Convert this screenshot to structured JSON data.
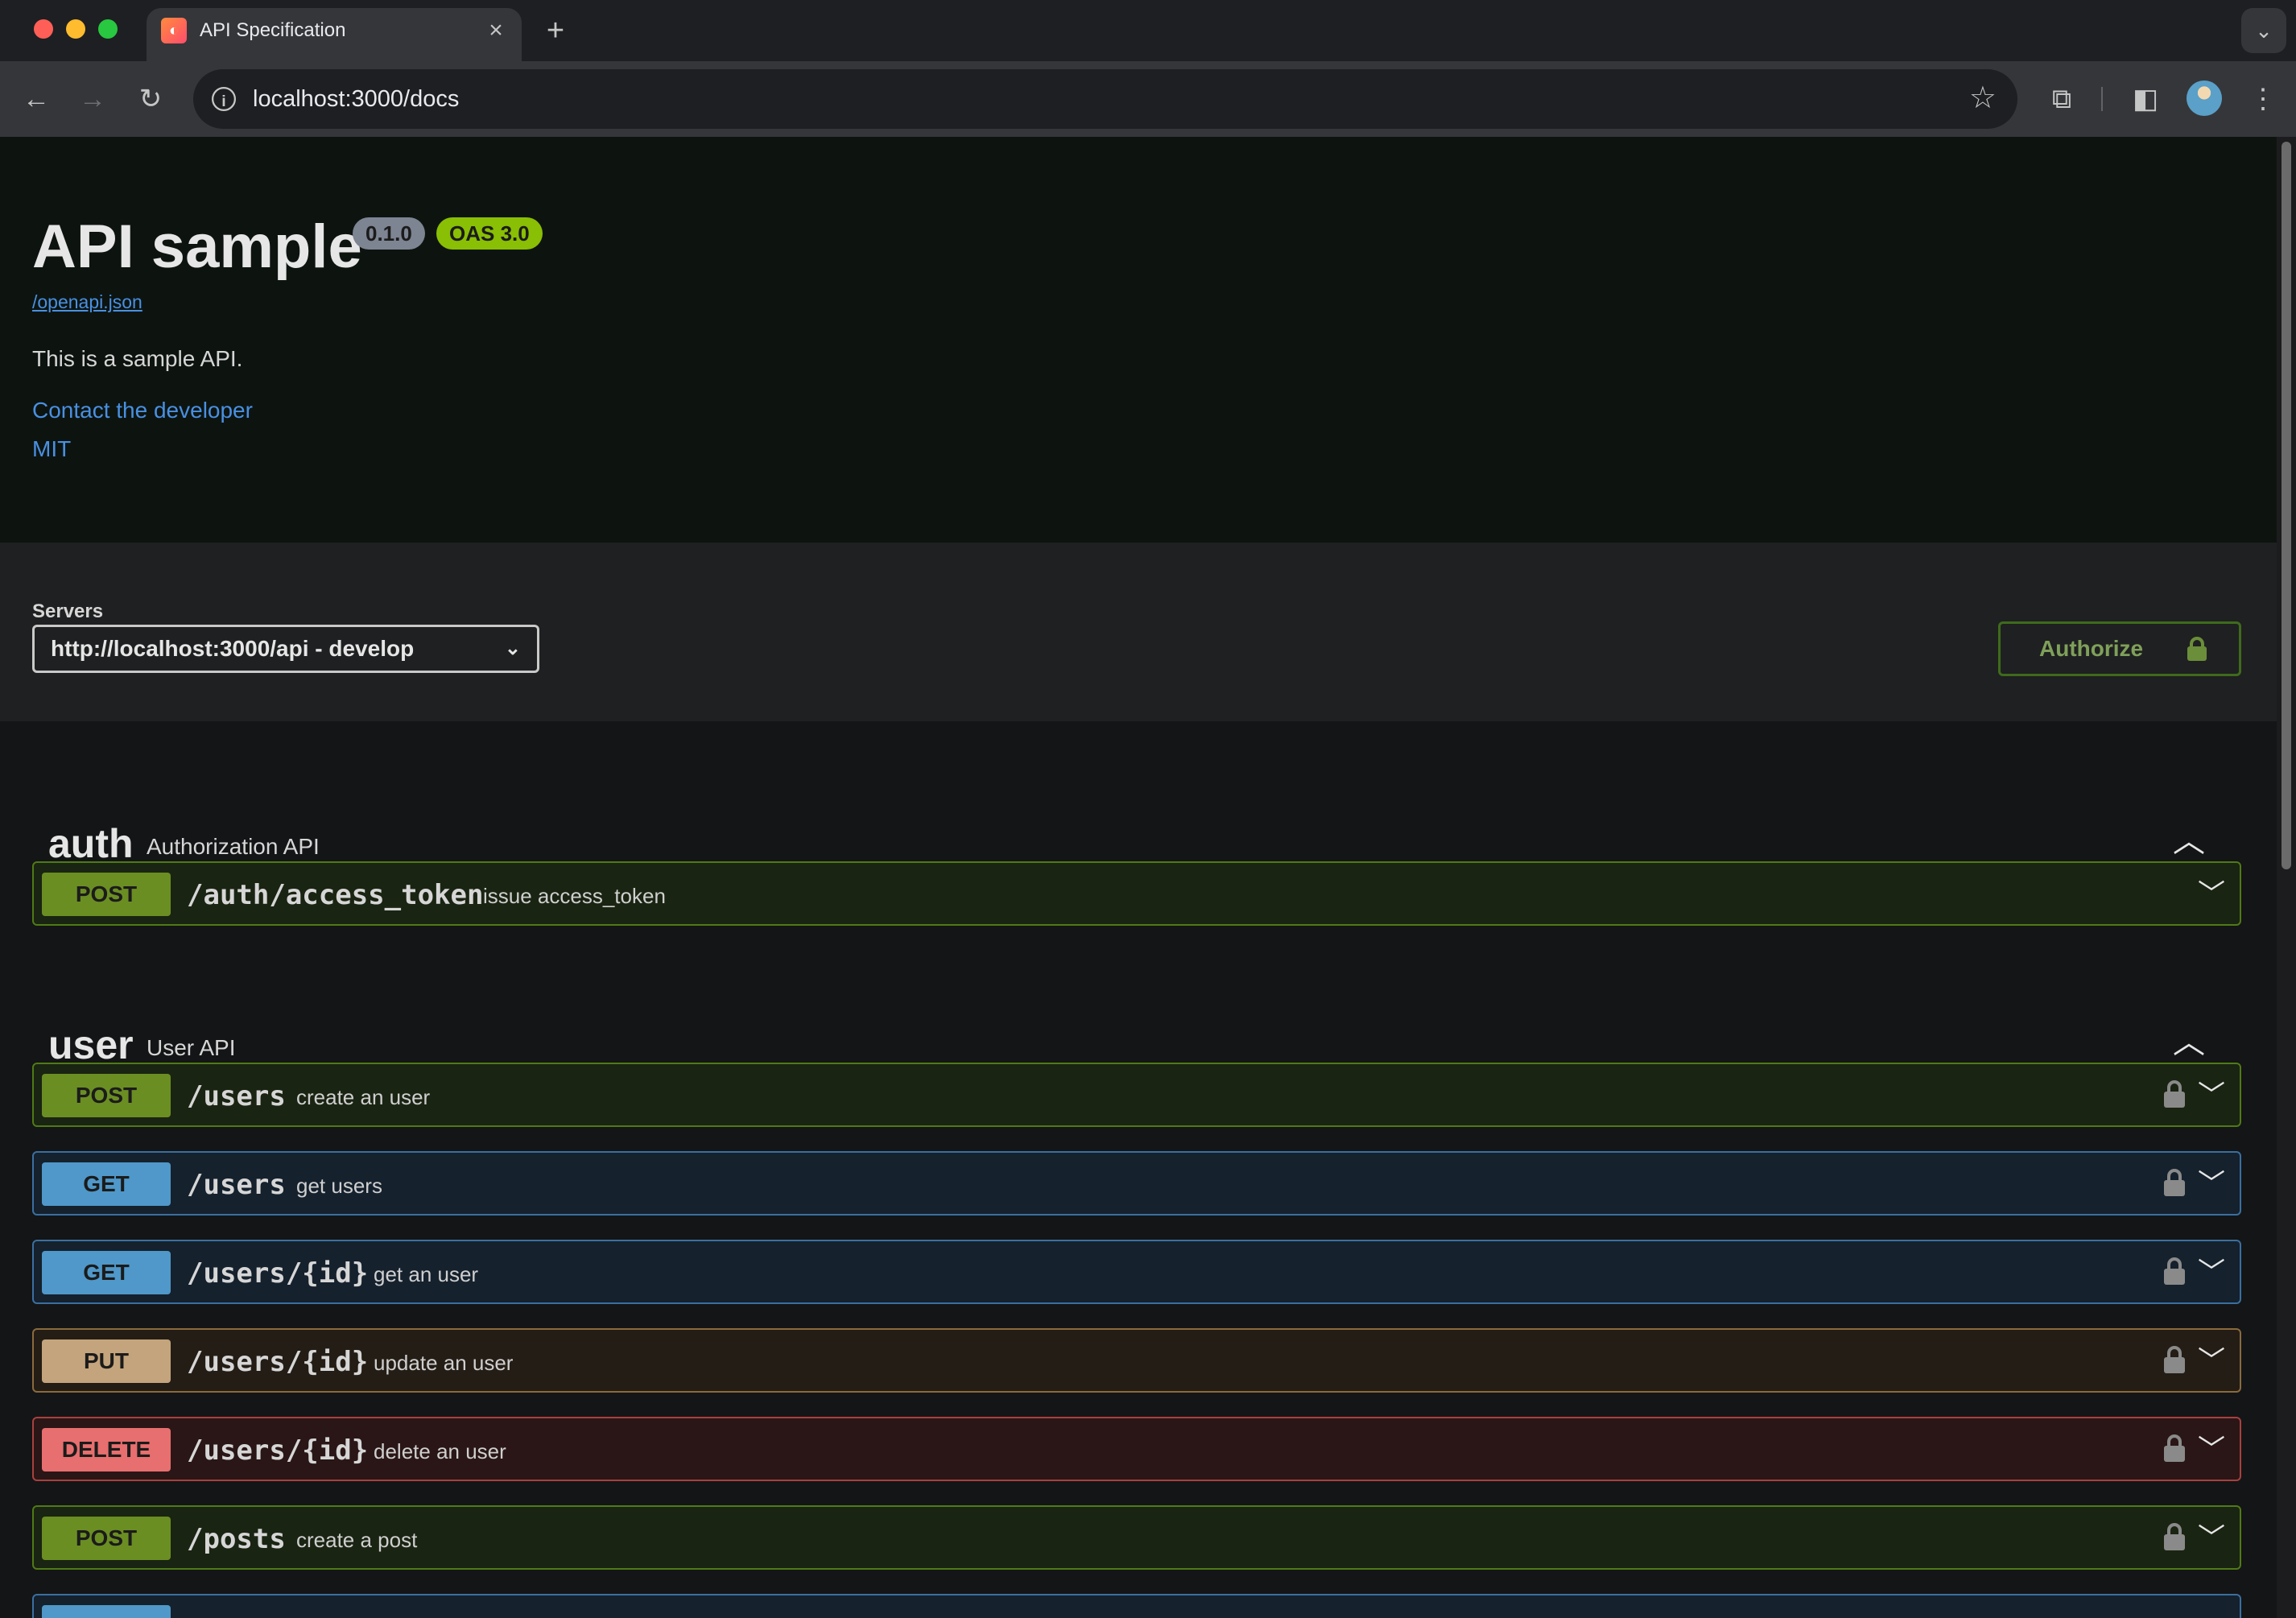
{
  "browser": {
    "tab_title": "API Specification",
    "tab_close": "×",
    "new_tab": "+",
    "url": "localhost:3000/docs",
    "icons": [
      "back-icon",
      "forward-icon",
      "reload-icon",
      "info-icon",
      "star-icon",
      "extensions-icon",
      "side-panel-icon",
      "profile-avatar",
      "more-icon"
    ]
  },
  "info": {
    "title": "API sample",
    "version": "0.1.0",
    "oas": "OAS 3.0",
    "spec_link": "/openapi.json",
    "description": "This is a sample API.",
    "contact": "Contact the developer",
    "license": "MIT"
  },
  "servers": {
    "label": "Servers",
    "selected": "http://localhost:3000/api - develop"
  },
  "authorize": {
    "label": "Authorize"
  },
  "tags": [
    {
      "name": "auth",
      "description": "Authorization API"
    },
    {
      "name": "user",
      "description": "User API"
    }
  ],
  "operations": [
    {
      "method": "POST",
      "path": "/auth/access_token",
      "summary": "issue access_token",
      "locked": false
    },
    {
      "method": "POST",
      "path": "/users",
      "summary": "create an user",
      "locked": true
    },
    {
      "method": "GET",
      "path": "/users",
      "summary": "get users",
      "locked": true
    },
    {
      "method": "GET",
      "path": "/users/{id}",
      "summary": "get an user",
      "locked": true
    },
    {
      "method": "PUT",
      "path": "/users/{id}",
      "summary": "update an user",
      "locked": true
    },
    {
      "method": "DELETE",
      "path": "/users/{id}",
      "summary": "delete an user",
      "locked": true
    },
    {
      "method": "POST",
      "path": "/posts",
      "summary": "create a post",
      "locked": true
    }
  ],
  "colors": {
    "post": "#6b8e23",
    "get": "#4f98c9",
    "put": "#c4a47c",
    "delete": "#e86f6f",
    "link": "#4990e2"
  }
}
